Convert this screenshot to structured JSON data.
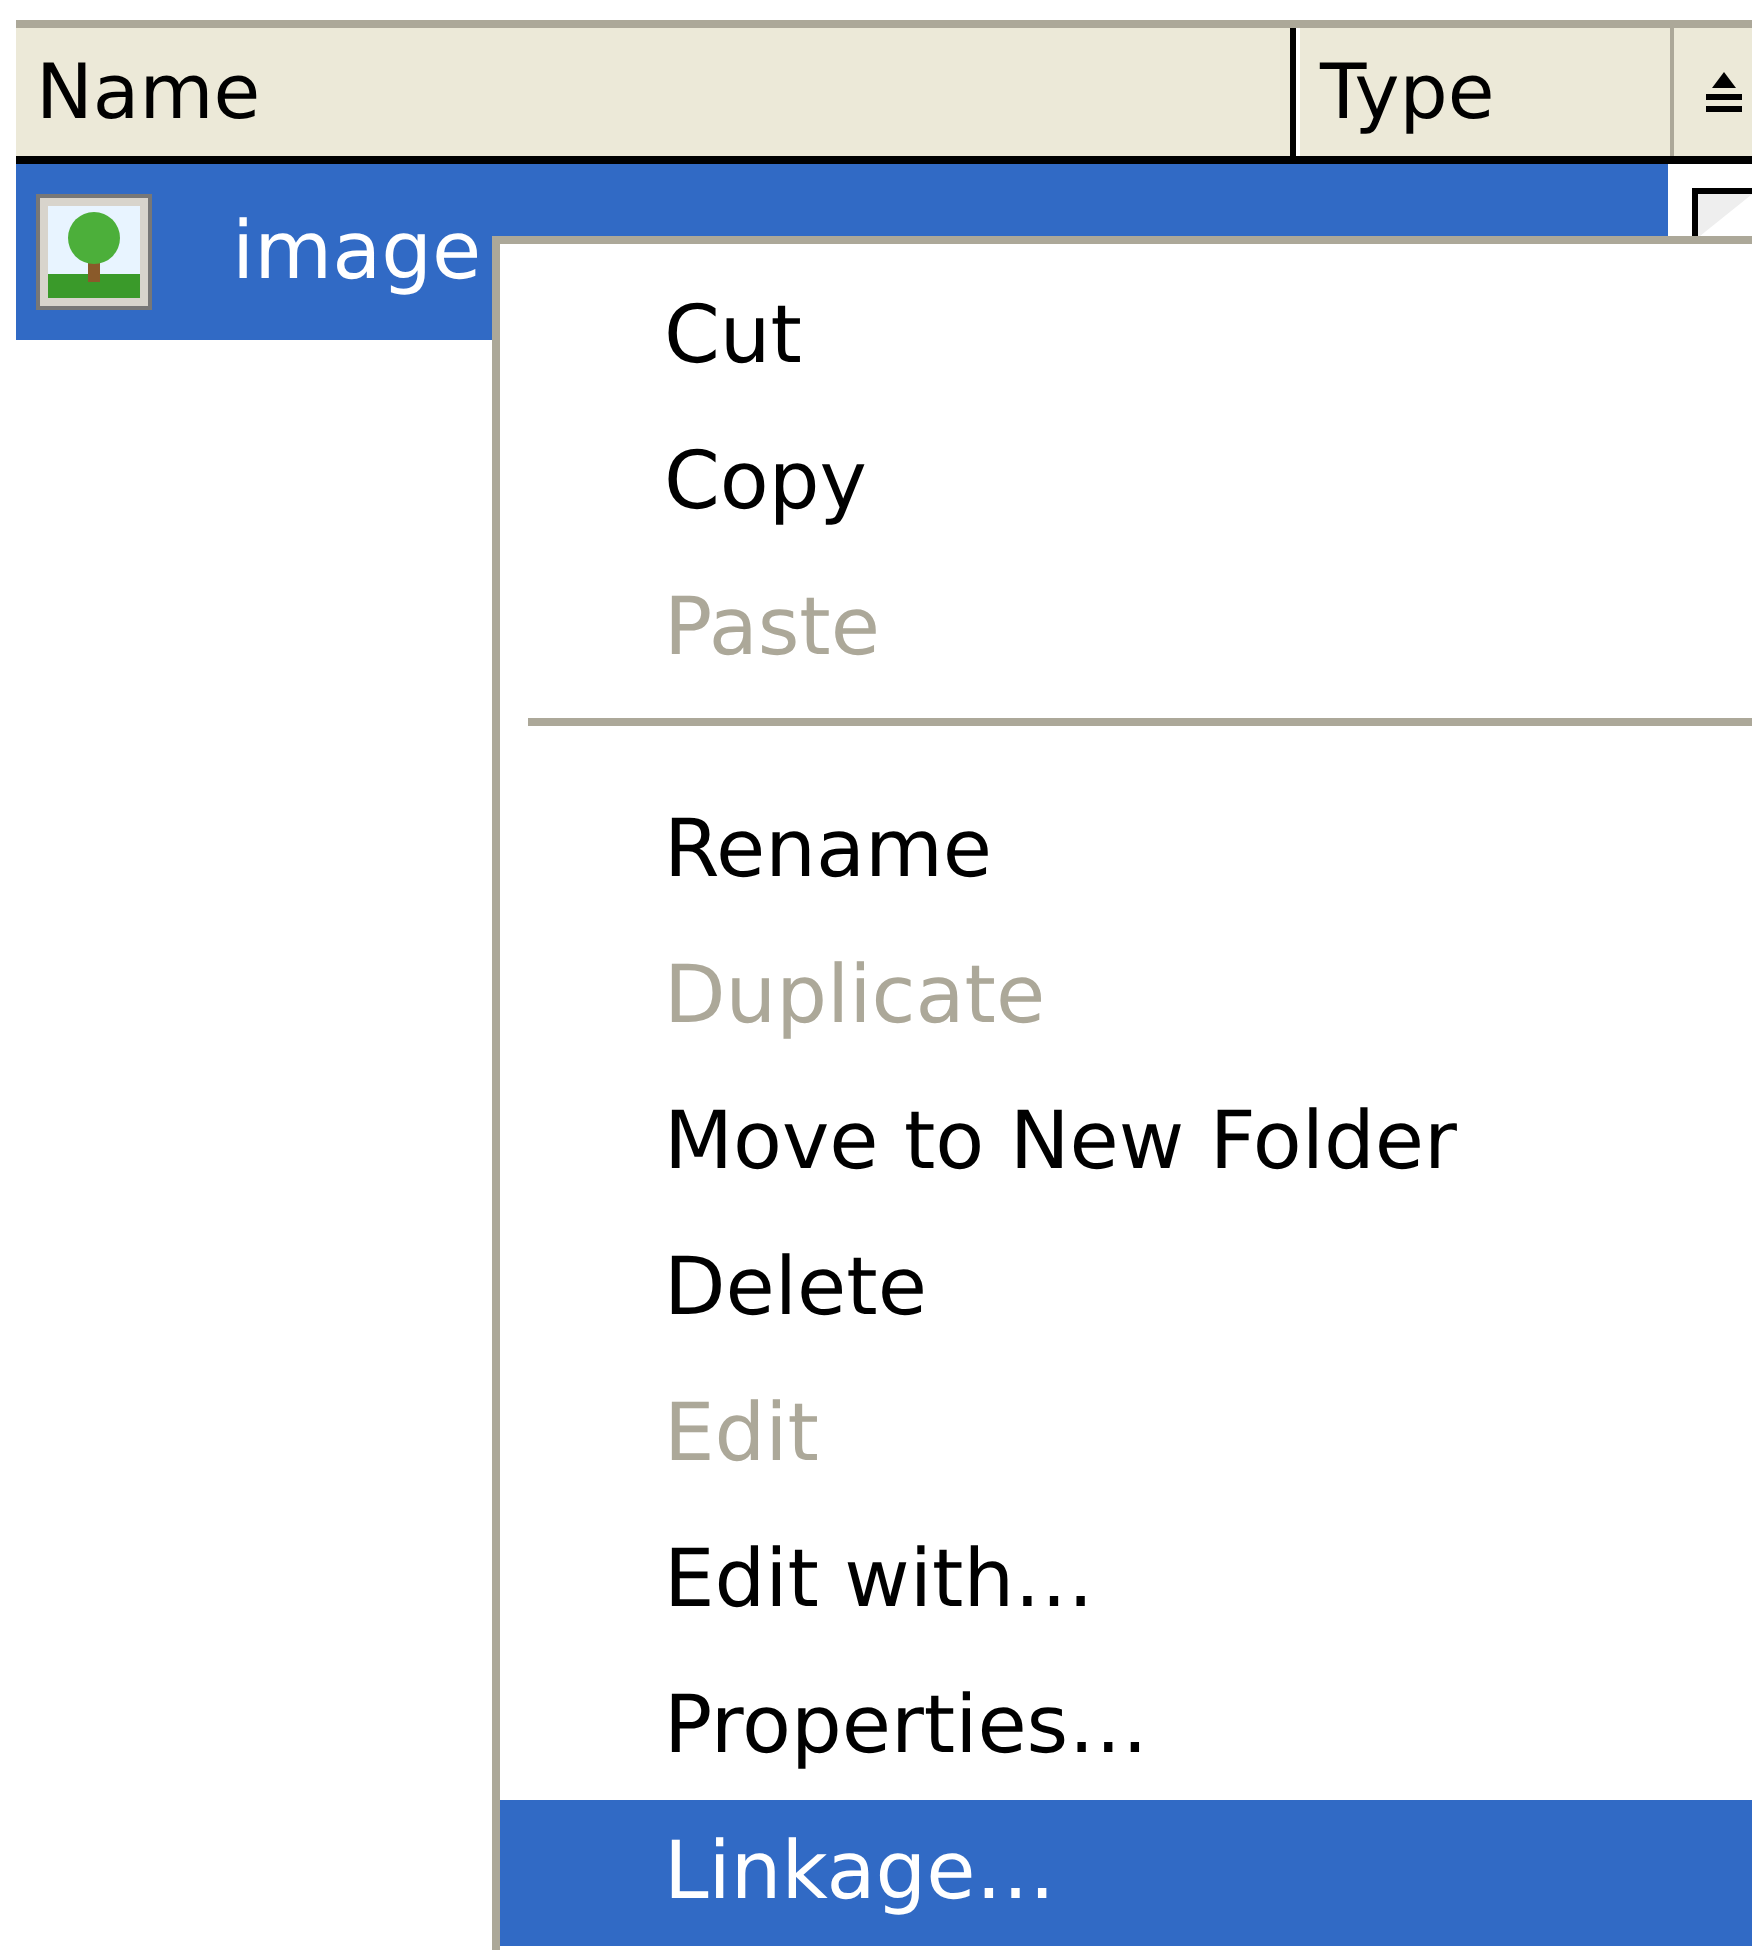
{
  "list": {
    "columns": [
      {
        "label": "Name"
      },
      {
        "label": "Type"
      },
      {
        "kind": "sort"
      }
    ],
    "rows": [
      {
        "name": "image",
        "selected": true
      }
    ]
  },
  "context_menu": [
    {
      "kind": "item",
      "label": "Cut",
      "disabled": false,
      "selected": false
    },
    {
      "kind": "item",
      "label": "Copy",
      "disabled": false,
      "selected": false
    },
    {
      "kind": "item",
      "label": "Paste",
      "disabled": true,
      "selected": false
    },
    {
      "kind": "separator"
    },
    {
      "kind": "item",
      "label": "Rename",
      "disabled": false,
      "selected": false
    },
    {
      "kind": "item",
      "label": "Duplicate",
      "disabled": true,
      "selected": false
    },
    {
      "kind": "item",
      "label": "Move to New Folder",
      "disabled": false,
      "selected": false
    },
    {
      "kind": "item",
      "label": "Delete",
      "disabled": false,
      "selected": false
    },
    {
      "kind": "item",
      "label": "Edit",
      "disabled": true,
      "selected": false
    },
    {
      "kind": "item",
      "label": "Edit with…",
      "disabled": false,
      "selected": false
    },
    {
      "kind": "item",
      "label": "Properties…",
      "disabled": false,
      "selected": false
    },
    {
      "kind": "item",
      "label": "Linkage…",
      "disabled": false,
      "selected": true
    }
  ]
}
